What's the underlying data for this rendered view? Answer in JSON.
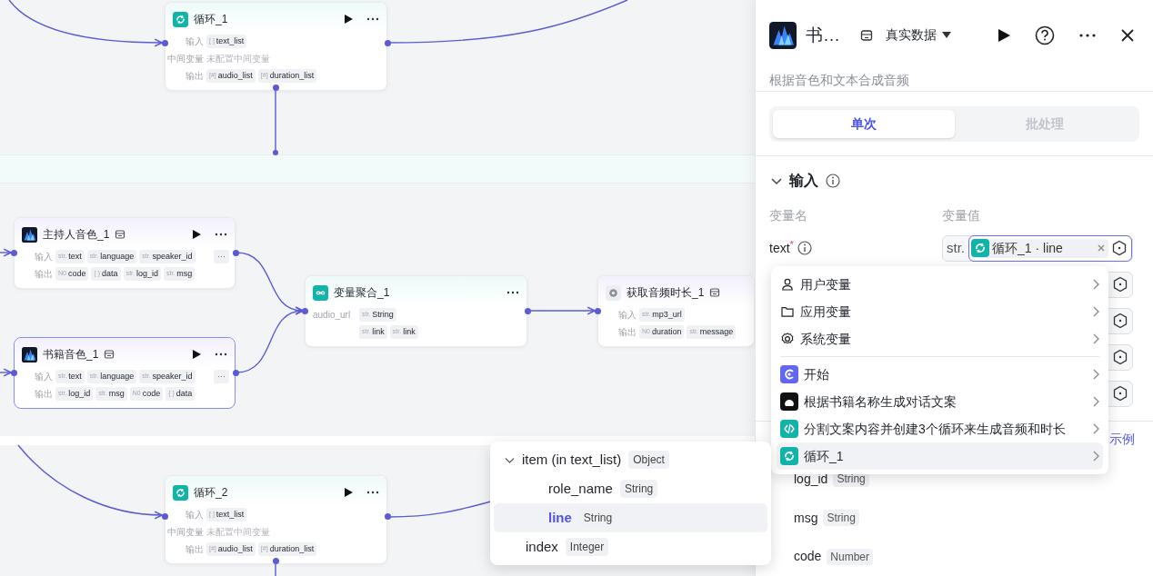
{
  "canvas": {
    "nodes": [
      {
        "title": "循环_1",
        "kind": "loop",
        "selected": false,
        "store": false,
        "run": true,
        "menu": true,
        "rows": [
          {
            "label": "输入",
            "chips": [
              {
                "prefix": "[ ]",
                "name": "text_list"
              }
            ]
          },
          {
            "label": "中间变量",
            "note": "未配置中间变量"
          },
          {
            "label": "输出",
            "chips": [
              {
                "prefix": "[#]",
                "name": "audio_list"
              },
              {
                "prefix": "[#]",
                "name": "duration_list"
              }
            ]
          }
        ]
      },
      {
        "title": "主持人音色_1",
        "kind": "voice",
        "selected": false,
        "store": true,
        "run": true,
        "menu": true,
        "rows": [
          {
            "label": "输入",
            "chips": [
              {
                "prefix": "str.",
                "name": "text"
              },
              {
                "prefix": "str.",
                "name": "language"
              },
              {
                "prefix": "str.",
                "name": "speaker_id"
              }
            ],
            "more": "···"
          },
          {
            "label": "输出",
            "chips": [
              {
                "prefix": "N0",
                "name": "code"
              },
              {
                "prefix": "{ }",
                "name": "data"
              },
              {
                "prefix": "str.",
                "name": "log_id"
              },
              {
                "prefix": "str.",
                "name": "msg"
              }
            ]
          }
        ]
      },
      {
        "title": "书籍音色_1",
        "kind": "voice",
        "selected": true,
        "store": true,
        "run": true,
        "menu": true,
        "rows": [
          {
            "label": "输入",
            "chips": [
              {
                "prefix": "str.",
                "name": "text"
              },
              {
                "prefix": "str.",
                "name": "language"
              },
              {
                "prefix": "str.",
                "name": "speaker_id"
              }
            ],
            "more": "···"
          },
          {
            "label": "输出",
            "chips": [
              {
                "prefix": "str.",
                "name": "log_id"
              },
              {
                "prefix": "str.",
                "name": "msg"
              },
              {
                "prefix": "N0",
                "name": "code"
              },
              {
                "prefix": "{ }",
                "name": "data"
              }
            ]
          }
        ]
      },
      {
        "title": "变量聚合_1",
        "kind": "merge",
        "selected": false,
        "store": false,
        "run": false,
        "menu": true,
        "rows": [
          {
            "label": "audio_url",
            "chips": [
              {
                "prefix": "str.",
                "name": "String"
              }
            ]
          },
          {
            "label": "",
            "chips": [
              {
                "prefix": "str.",
                "name": "link"
              },
              {
                "prefix": "str.",
                "name": "link"
              }
            ]
          }
        ]
      },
      {
        "title": "获取音频时长_1",
        "kind": "plugin",
        "selected": false,
        "store": true,
        "run": false,
        "menu": false,
        "rows": [
          {
            "label": "输入",
            "chips": [
              {
                "prefix": "str.",
                "name": "mp3_url"
              }
            ]
          },
          {
            "label": "输出",
            "chips": [
              {
                "prefix": "N0",
                "name": "duration"
              },
              {
                "prefix": "str.",
                "name": "message"
              }
            ]
          }
        ]
      },
      {
        "title": "循环_2",
        "kind": "loop",
        "selected": false,
        "store": false,
        "run": true,
        "menu": true,
        "rows": [
          {
            "label": "输入",
            "chips": [
              {
                "prefix": "[ ]",
                "name": "text_list"
              }
            ]
          },
          {
            "label": "中间变量",
            "note": "未配置中间变量"
          },
          {
            "label": "输出",
            "chips": [
              {
                "prefix": "[#]",
                "name": "audio_list"
              },
              {
                "prefix": "[#]",
                "name": "duration_list"
              }
            ]
          }
        ]
      }
    ]
  },
  "panel": {
    "title": "书…",
    "mode": "真实数据",
    "description": "根据音色和文本合成音频",
    "tabs": [
      {
        "label": "单次",
        "selected": true
      },
      {
        "label": "批处理",
        "selected": false
      }
    ],
    "input_section": {
      "title": "输入",
      "expanded": true,
      "columns": [
        "变量名",
        "变量值"
      ],
      "text_row": {
        "name": "text",
        "required_mark": "*",
        "type": "str.",
        "value": "循环_1 · line"
      },
      "covered_rows": [
        {
          "kind": "variable"
        },
        {
          "kind": "variable"
        },
        {
          "kind": "variable"
        },
        {
          "kind": "variable"
        }
      ]
    },
    "example_link": "示例",
    "outputs": [
      {
        "name": "log_id",
        "type": "String"
      },
      {
        "name": "msg",
        "type": "String"
      },
      {
        "name": "code",
        "type": "Number"
      }
    ]
  },
  "variable_menu": [
    {
      "label": "用户变量",
      "kind": "user",
      "selected": false
    },
    {
      "label": "应用变量",
      "kind": "folder",
      "selected": false
    },
    {
      "label": "系统变量",
      "kind": "gear",
      "selected": false
    },
    {
      "label": "开始",
      "kind": "start",
      "selected": false
    },
    {
      "label": "根据书籍名称生成对话文案",
      "kind": "llm",
      "selected": false
    },
    {
      "label": "分割文案内容并创建3个循环来生成音频和时长",
      "kind": "code",
      "selected": false
    },
    {
      "label": "循环_1",
      "kind": "loop",
      "selected": true
    }
  ],
  "submenu": [
    {
      "name": "item (in text_list)",
      "type": "Object",
      "expanded": true,
      "selected": false,
      "children": [
        {
          "name": "role_name",
          "type": "String",
          "selected": false
        },
        {
          "name": "line",
          "type": "String",
          "selected": true
        }
      ]
    },
    {
      "name": "index",
      "type": "Integer",
      "selected": false
    }
  ]
}
